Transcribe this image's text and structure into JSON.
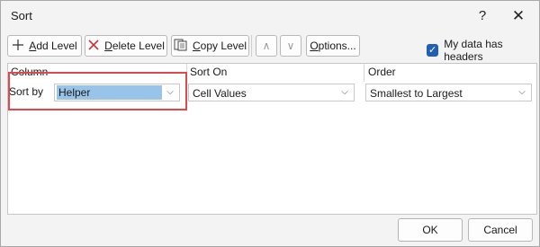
{
  "window": {
    "title": "Sort",
    "help_glyph": "?",
    "close_glyph": "✕"
  },
  "toolbar": {
    "add_level": {
      "icon": "plus-icon",
      "ul": "A",
      "rest": "dd Level"
    },
    "delete_level": {
      "icon": "x-icon",
      "ul": "D",
      "rest": "elete Level"
    },
    "copy_level": {
      "icon": "copy-icon",
      "ul": "C",
      "rest": "opy Level"
    },
    "move_up": {
      "icon": "chevron-up-icon",
      "glyph": "∧"
    },
    "move_down": {
      "icon": "chevron-down-icon",
      "glyph": "∨"
    },
    "options": {
      "ul": "O",
      "rest": "ptions..."
    }
  },
  "headers_checkbox": {
    "label": "My data has headers",
    "checked": true,
    "check_glyph": "✓"
  },
  "grid": {
    "columns": [
      "Column",
      "Sort On",
      "Order"
    ],
    "rows": [
      {
        "label": "Sort by",
        "column": "Helper",
        "sort_on": "Cell Values",
        "order": "Smallest to Largest"
      }
    ],
    "chevron_glyph": "⌵"
  },
  "footer": {
    "ok": "OK",
    "cancel": "Cancel"
  },
  "colors": {
    "accent": "#1f5fb5",
    "highlight": "#e0484d",
    "selection": "#99c4ea"
  }
}
